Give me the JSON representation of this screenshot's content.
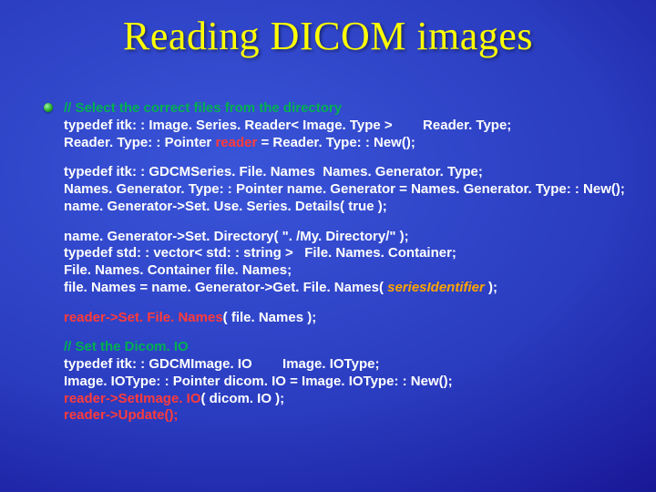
{
  "title": "Reading DICOM images",
  "lines": {
    "c1": "// Select the correct files from the directory",
    "l2a": "typedef itk: : Image. Series. Reader< Image. Type >",
    "l2b": "Reader. Type;",
    "l3a": "Reader. Type: : Pointer ",
    "l3b": "reader",
    "l3c": " = Reader. Type: : New();",
    "l4": "typedef itk: : GDCMSeries. File. Names  Names. Generator. Type;",
    "l5": "Names. Generator. Type: : Pointer name. Generator = Names. Generator. Type: : New();",
    "l6": "name. Generator->Set. Use. Series. Details( true );",
    "l7": "name. Generator->Set. Directory( \". /My. Directory/\" );",
    "l8": "typedef std: : vector< std: : string >   File. Names. Container;",
    "l9": "File. Names. Container file. Names;",
    "l10a": "file. Names = name. Generator->Get. File. Names( ",
    "l10b": "seriesIdentifier",
    "l10c": " );",
    "l11a": "reader->Set. File. Names",
    "l11b": "( file. Names );",
    "c2": "// Set the Dicom. IO",
    "l12": "typedef itk: : GDCMImage. IO        Image. IOType;",
    "l13": "Image. IOType: : Pointer dicom. IO = Image. IOType: : New();",
    "l14a": "reader->SetImage. IO",
    "l14b": "( dicom. IO );",
    "l15": "reader->Update();"
  }
}
